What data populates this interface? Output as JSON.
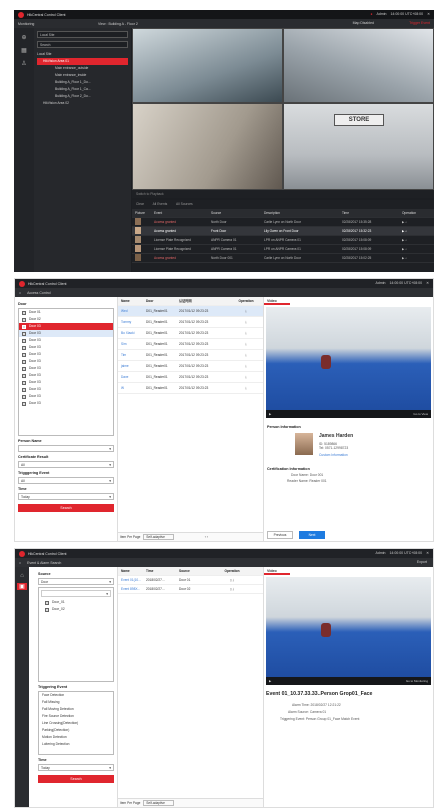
{
  "p1": {
    "app_title": "HikCentral Control Client",
    "tab": "Monitoring",
    "view_title": "View : Building A - Floor 2",
    "user": "Admin",
    "time": "14:00:00 UTC+08:00",
    "map_disabled": "Map Disabled",
    "trigger_event": "Trigger Event",
    "search_placeholder": "Search",
    "site_select": "Local Site",
    "tree": [
      "Local Site",
      "HikVision Area 01",
      "Main entrance_outside",
      "Main entrance_inside",
      "Building A_Floor 1_Do...",
      "Building A_Floor 1_Ca...",
      "Building A_Floor 2_Do...",
      "HikVision Area 02"
    ],
    "store_sign": "STORE",
    "switch_playback": "Switch to Playback",
    "toolbar": {
      "clear": "Clear",
      "all_events": "All Events",
      "all_sources": "All Sources"
    },
    "headers": [
      "Picture",
      "Event",
      "Source",
      "Description",
      "Time",
      "Operation"
    ],
    "rows": [
      [
        "Access granted",
        "North Door",
        "Carlie Lynn on North Door",
        "02/28/2017 15:35:28"
      ],
      [
        "Access granted",
        "Front Door",
        "Lily Owen on Front Door",
        "02/28/2017 15:32:23"
      ],
      [
        "License Plate Recognized",
        "ANPR Camera 01",
        "LPR on ANPR Camera 01",
        "02/28/2017 15:08:09"
      ],
      [
        "License Plate Recognized",
        "ANPR Camera 01",
        "LPR on ANPR Camera 01",
        "02/28/2017 15:08:09"
      ],
      [
        "Access granted",
        "North Door 001",
        "Carlie Lynn on North Door",
        "02/28/2017 15:02:25"
      ]
    ]
  },
  "p2": {
    "app_title": "HikCentral Control Client",
    "user": "Admin",
    "time": "14:00:00 UTC+08:00",
    "tab": "Access Control",
    "door_label": "Door",
    "doors": [
      "Door 01",
      "Door 02",
      "Door 03",
      "Door 03",
      "Door 03",
      "Door 03",
      "Door 03",
      "Door 03",
      "Door 03",
      "Door 03",
      "Door 03",
      "Door 03",
      "Door 03",
      "Door 03"
    ],
    "person_name_label": "Person Name",
    "cert_label": "Certificate Result",
    "cert_val": "All",
    "trig_label": "Trigggering Event",
    "trig_val": "All",
    "time_label": "Time",
    "time_val": "Today",
    "search_btn": "Search",
    "headers": [
      "Name",
      "Door",
      "认证时间",
      "Operation"
    ],
    "rows": [
      [
        "Wed",
        "D01_Reader01",
        "2017/01/12 09:23:23"
      ],
      [
        "Tommy",
        "D01_Reader01",
        "2017/01/12 09:23:23"
      ],
      [
        "Bo Xiaoki",
        "D01_Reader01",
        "2017/01/12 09:23:23"
      ],
      [
        "Sim",
        "D01_Reader01",
        "2017/01/12 09:23:23"
      ],
      [
        "Tim",
        "D01_Reader01",
        "2017/01/12 09:23:23"
      ],
      [
        "jaime",
        "D01_Reader01",
        "2017/01/12 09:23:23"
      ],
      [
        "Dave",
        "D01_Reader01",
        "2017/01/12 09:23:23"
      ],
      [
        "W",
        "D01_Reader01",
        "2017/01/12 09:23:23"
      ]
    ],
    "pager": "Item Per Page",
    "pager_val": "Self-adaptive",
    "video_tab": "Video",
    "go_live": "Go to View",
    "person_info": "Person Information",
    "person_name": "James Harden",
    "person_id": "ID:  5189866",
    "person_tel": "Tel:  0571-12998723",
    "custom_info": "Custom Information",
    "cert_info": "Certification Information",
    "door_name_k": "Door Name:",
    "door_name_v": "Door 001",
    "reader_k": "Reader Name:",
    "reader_v": "Reader 001",
    "prev": "Previous",
    "next": "Next"
  },
  "p3": {
    "app_title": "HikCentral Control Client",
    "user": "Admin",
    "time": "14:00:00 UTC+08:00",
    "tab": "Event & Alarm Search",
    "export": "Export",
    "source_label": "Source",
    "source_val": "Door",
    "doors": [
      "Door_01",
      "Door_02"
    ],
    "trig_label": "Triggering Event",
    "events": [
      "Face Detection",
      "Fall Missing",
      "Fall Moving Detection",
      "Fire Source Detection",
      "Line Crossing(Detection)",
      "Parking(Detection)",
      "Motion Detection",
      "Loitering Detection"
    ],
    "time_label": "Time",
    "time_val": "Today",
    "search_btn": "Search",
    "headers": [
      "Name",
      "Time",
      "Source",
      "Operation"
    ],
    "rows": [
      [
        "Event 01(10...",
        "2018/02/27...",
        "Door 01"
      ],
      [
        "Event 898X...",
        "2018/02/27...",
        "Door 02"
      ]
    ],
    "pager": "Item Per Page",
    "pager_val": "Self-adaptive",
    "video_tab": "Video",
    "go_mon": "Go to Monitoring",
    "event_title": "Event 01_10.37.33.33..Person Grop01_Face",
    "alarm_time_k": "Alarm Time:",
    "alarm_time_v": "2018/02/27 12:21:22",
    "alarm_src_k": "Alarm Source:",
    "alarm_src_v": "Camera 01",
    "trig_k": "Triggering Event:",
    "trig_v": "Person Group 01_Face Match Event"
  }
}
